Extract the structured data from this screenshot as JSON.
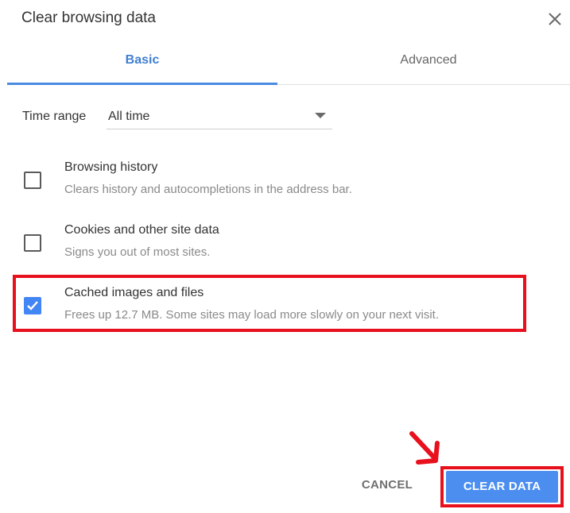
{
  "dialog": {
    "title": "Clear browsing data"
  },
  "tabs": [
    {
      "label": "Basic",
      "active": true
    },
    {
      "label": "Advanced",
      "active": false
    }
  ],
  "time_range": {
    "label": "Time range",
    "value": "All time"
  },
  "options": [
    {
      "label": "Browsing history",
      "description": "Clears history and autocompletions in the address bar.",
      "checked": false
    },
    {
      "label": "Cookies and other site data",
      "description": "Signs you out of most sites.",
      "checked": false
    },
    {
      "label": "Cached images and files",
      "description": "Frees up 12.7 MB. Some sites may load more slowly on your next visit.",
      "checked": true
    }
  ],
  "buttons": {
    "cancel": "CANCEL",
    "clear": "CLEAR DATA"
  },
  "colors": {
    "accent": "#4285f4",
    "highlight": "#e8101c"
  }
}
